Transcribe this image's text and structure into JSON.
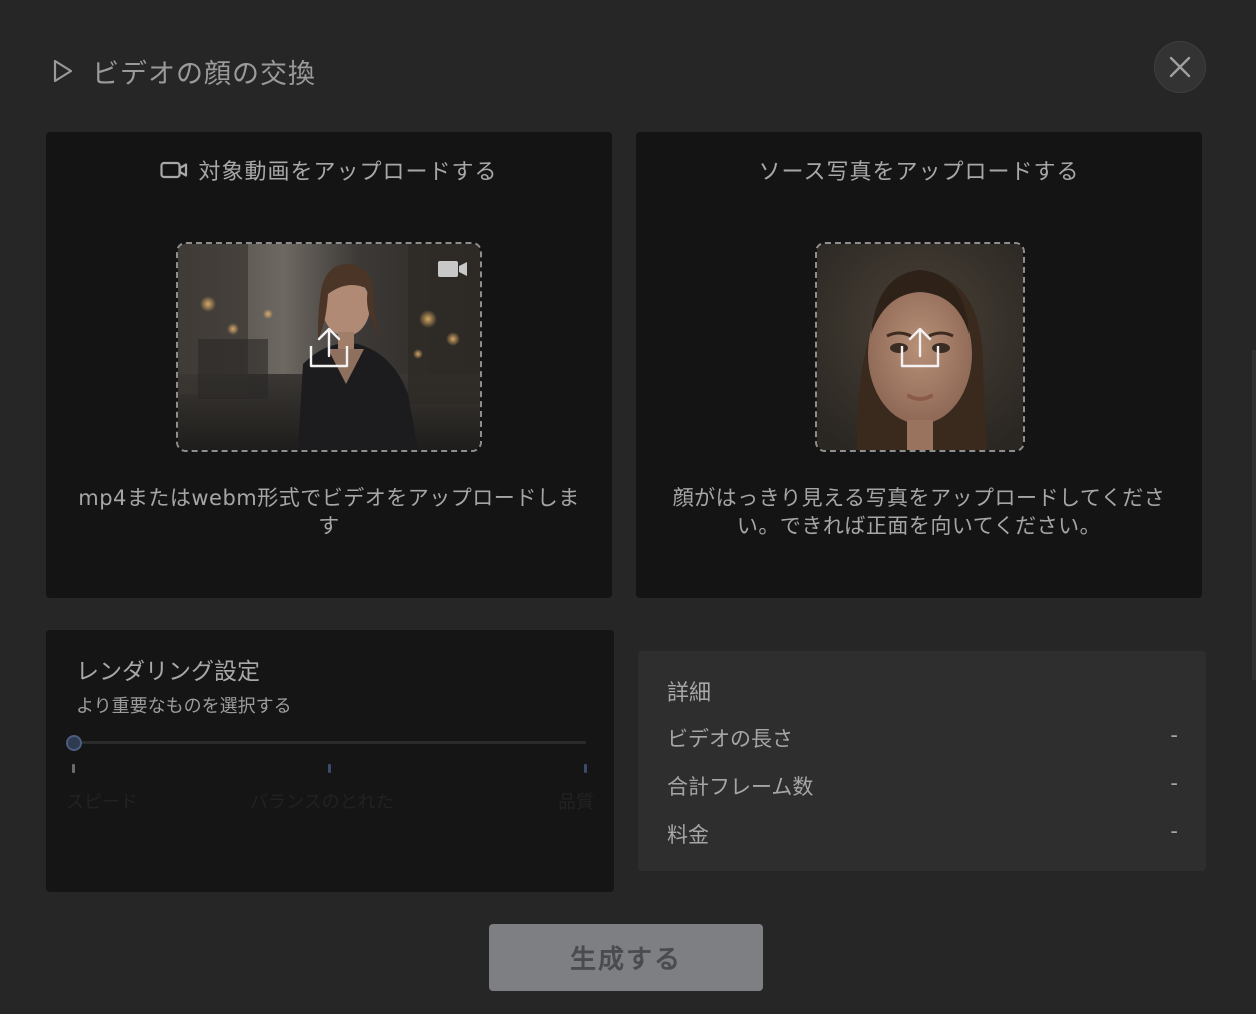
{
  "header": {
    "title": "ビデオの顔の交換",
    "play_icon": "play-outline-icon",
    "close_icon": "close-x-icon"
  },
  "upload_video": {
    "title": "対象動画をアップロードする",
    "title_icon": "video-camera-icon",
    "description": "mp4またはwebm形式でビデオをアップロードします",
    "badge_icon": "video-camera-icon",
    "upload_icon": "upload-arrow-icon"
  },
  "upload_photo": {
    "title": "ソース写真をアップロードする",
    "description": "顔がはっきり見える写真をアップロードしてください。できれば正面を向いてください。",
    "upload_icon": "upload-arrow-icon"
  },
  "render_settings": {
    "title": "レンダリング設定",
    "subtitle": "より重要なものを選択する",
    "options": [
      "スピード",
      "バランスのとれた",
      "品質"
    ],
    "selected_index": 0
  },
  "details": {
    "title": "詳細",
    "rows": [
      {
        "label": "ビデオの長さ",
        "value": "-"
      },
      {
        "label": "合計フレーム数",
        "value": "-"
      },
      {
        "label": "料金",
        "value": "-"
      }
    ]
  },
  "generate_button": {
    "label": "生成する"
  },
  "colors": {
    "background": "#262626",
    "card": "#141414",
    "details_panel": "#2e2e2e",
    "slider_accent": "#4b5d80",
    "button": "#7d7f83"
  }
}
